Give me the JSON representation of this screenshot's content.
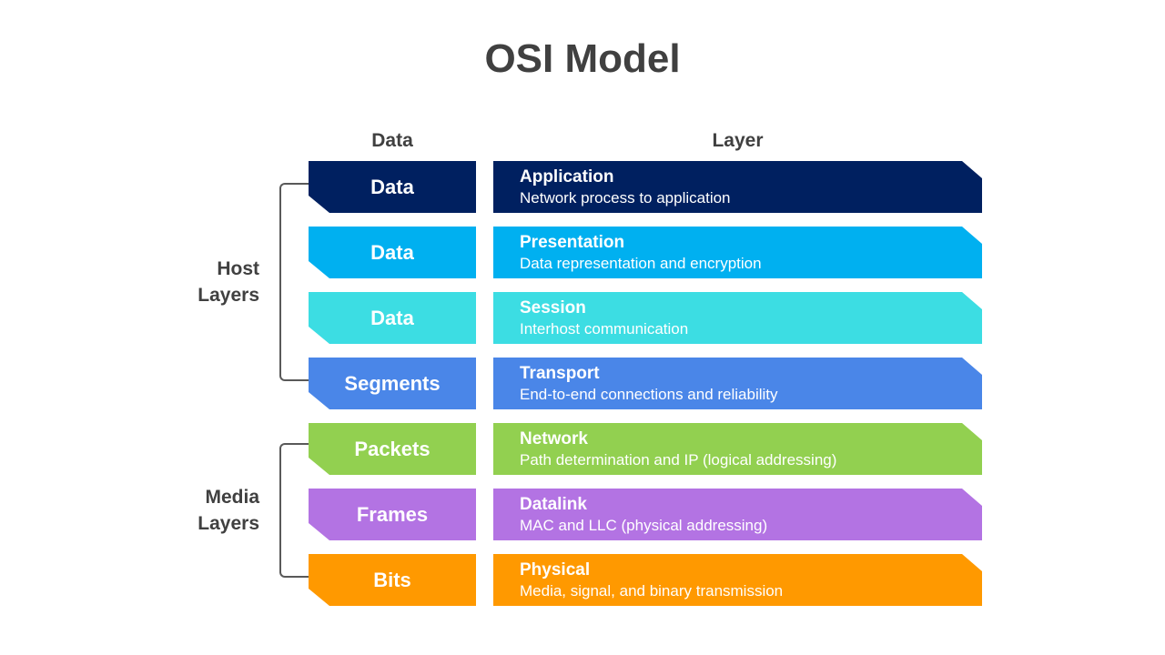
{
  "title": "OSI Model",
  "headers": {
    "data": "Data",
    "layer": "Layer"
  },
  "groups": [
    {
      "label_line1": "Host",
      "label_line2": "Layers"
    },
    {
      "label_line1": "Media",
      "label_line2": "Layers"
    }
  ],
  "layers": [
    {
      "data_unit": "Data",
      "name": "Application",
      "description": "Network process to application",
      "color": "#002060"
    },
    {
      "data_unit": "Data",
      "name": "Presentation",
      "description": "Data representation and encryption",
      "color": "#00B0F0"
    },
    {
      "data_unit": "Data",
      "name": "Session",
      "description": "Interhost communication",
      "color": "#3CDDE3"
    },
    {
      "data_unit": "Segments",
      "name": "Transport",
      "description": "End-to-end connections and reliability",
      "color": "#4A86E8"
    },
    {
      "data_unit": "Packets",
      "name": "Network",
      "description": "Path determination and IP (logical addressing)",
      "color": "#92D050"
    },
    {
      "data_unit": "Frames",
      "name": "Datalink",
      "description": "MAC and LLC (physical addressing)",
      "color": "#B373E3"
    },
    {
      "data_unit": "Bits",
      "name": "Physical",
      "description": "Media, signal, and binary transmission",
      "color": "#FF9900"
    }
  ]
}
